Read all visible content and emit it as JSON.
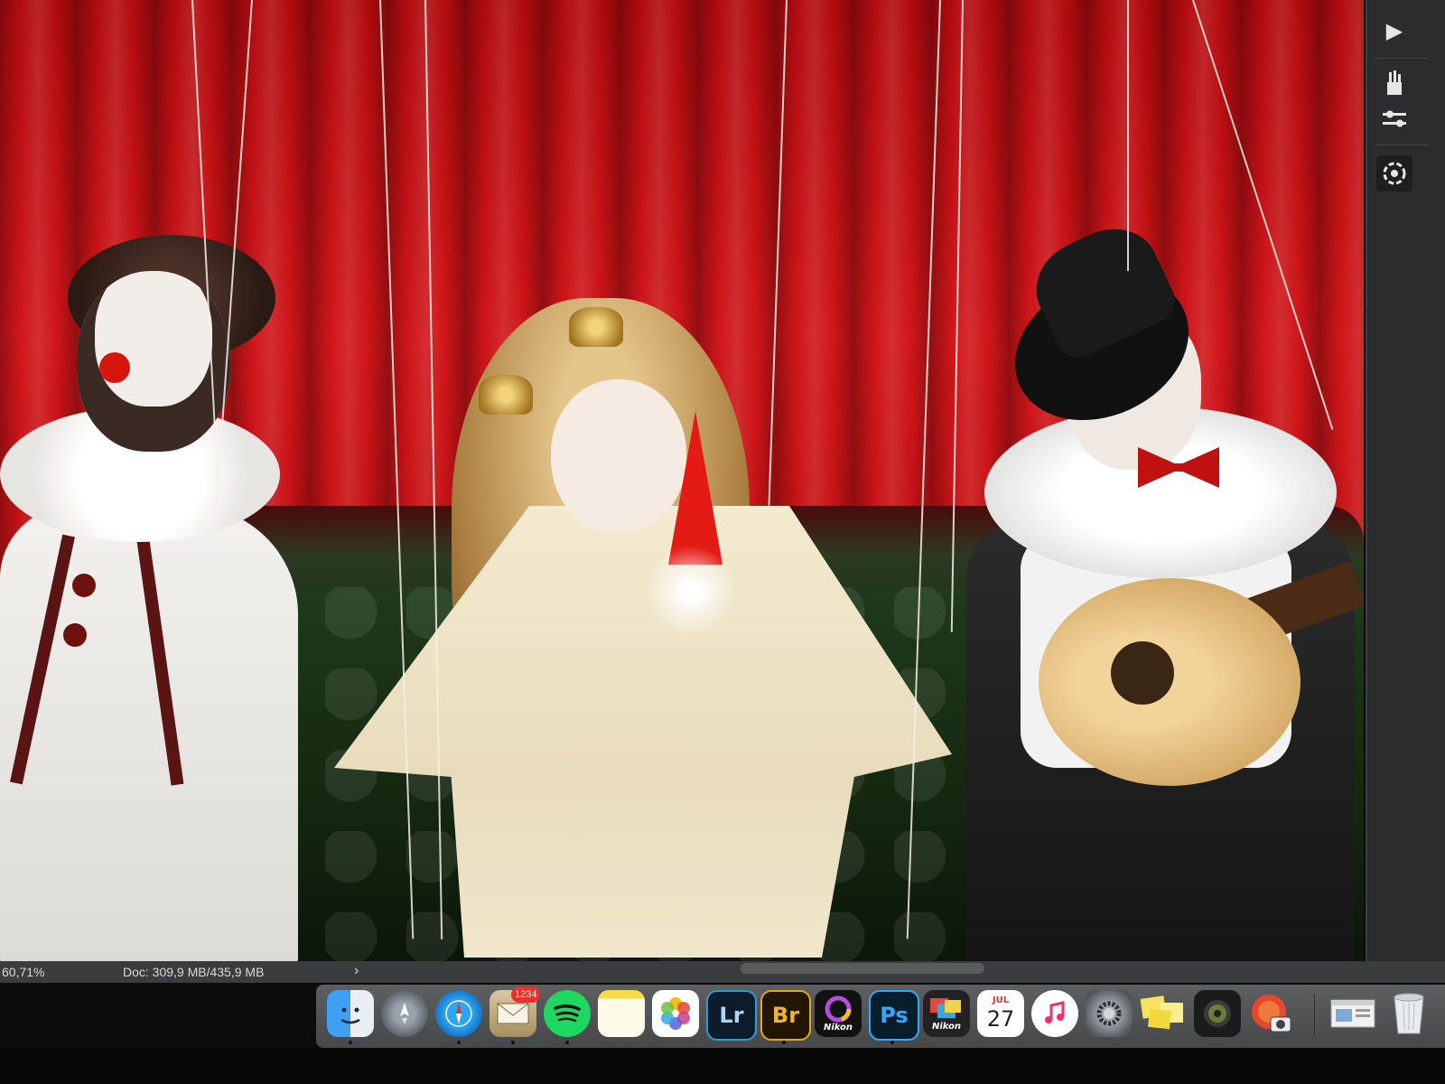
{
  "status_bar": {
    "zoom": "60,71%",
    "doc_info": "Doc: 309,9 MB/435,9 MB",
    "expand_arrow": "›"
  },
  "tool_strip": {
    "icons": [
      "play-icon",
      "brushes-icon",
      "adjustments-icon",
      "puppet-warp-icon"
    ]
  },
  "dock": {
    "apps": [
      {
        "name": "Finder",
        "icon": "finder-icon",
        "running": true
      },
      {
        "name": "Launchpad",
        "icon": "rocket-icon",
        "running": false
      },
      {
        "name": "Safari",
        "icon": "compass-icon",
        "running": true
      },
      {
        "name": "Mail",
        "icon": "mail-icon",
        "badge": "1234",
        "running": true
      },
      {
        "name": "Spotify",
        "icon": "spotify-icon",
        "running": true
      },
      {
        "name": "Notes",
        "icon": "notes-icon",
        "running": false
      },
      {
        "name": "Photos",
        "icon": "photos-icon",
        "running": false
      },
      {
        "name": "Lightroom",
        "label": "Lr",
        "running": false
      },
      {
        "name": "Bridge",
        "label": "Br",
        "running": true
      },
      {
        "name": "Nikon Capture",
        "label": "Nikon",
        "running": false
      },
      {
        "name": "Photoshop",
        "label": "Ps",
        "running": true
      },
      {
        "name": "Nikon Transfer",
        "label": "Nikon",
        "running": false
      },
      {
        "name": "Calendar",
        "label_month": "JUL",
        "label_day": "27",
        "running": false
      },
      {
        "name": "iTunes",
        "icon": "music-note-icon",
        "running": false
      },
      {
        "name": "System Preferences",
        "icon": "gear-icon",
        "running": false
      },
      {
        "name": "Stickies",
        "icon": "stickies-icon",
        "running": false
      },
      {
        "name": "Speaker Utility",
        "icon": "speaker-icon",
        "running": false
      },
      {
        "name": "Image Capture",
        "icon": "camera-icon",
        "running": false
      },
      {
        "name": "Preview Window",
        "icon": "window-thumbnail-icon",
        "running": false
      },
      {
        "name": "Trash",
        "icon": "trash-icon",
        "running": false
      }
    ]
  },
  "colors": {
    "curtain": "#c8141a",
    "sofa": "#1d3318",
    "ui_dark": "#2b2c2e",
    "status_bar": "#3b3c3e"
  }
}
